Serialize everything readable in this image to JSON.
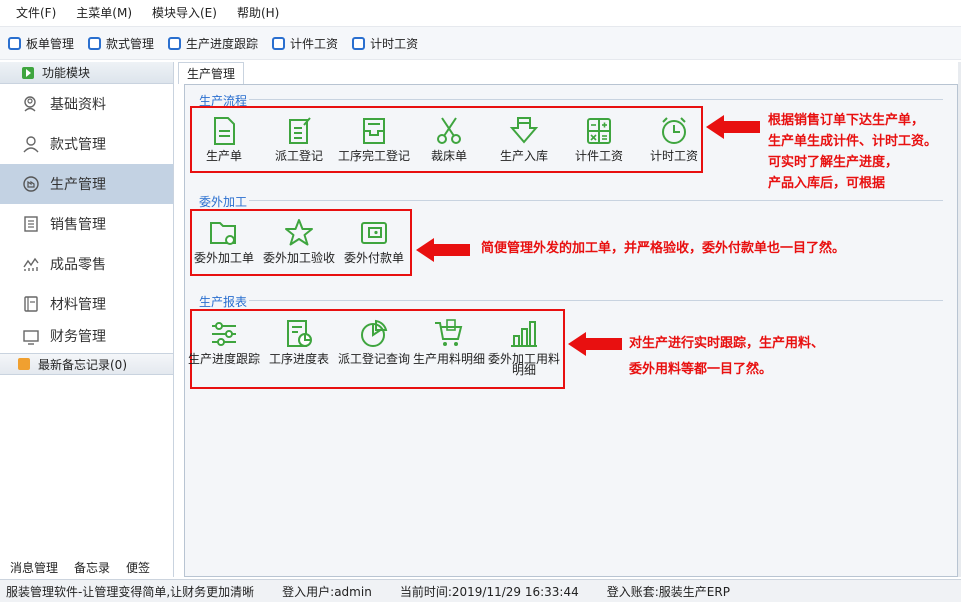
{
  "menu": [
    "文件(F)",
    "主菜单(M)",
    "模块导入(E)",
    "帮助(H)"
  ],
  "toolbar": [
    "板单管理",
    "款式管理",
    "生产进度跟踪",
    "计件工资",
    "计时工资"
  ],
  "sidebar": {
    "header": "功能模块",
    "items": [
      {
        "label": "基础资料",
        "icon": "search-user-icon",
        "active": false
      },
      {
        "label": "款式管理",
        "icon": "user-icon",
        "active": false
      },
      {
        "label": "生产管理",
        "icon": "factory-icon",
        "active": true
      },
      {
        "label": "销售管理",
        "icon": "document-icon",
        "active": false
      },
      {
        "label": "成品零售",
        "icon": "chart-icon",
        "active": false
      },
      {
        "label": "材料管理",
        "icon": "notebook-icon",
        "active": false
      },
      {
        "label": "财务管理",
        "icon": "monitor-icon",
        "active": false
      }
    ],
    "memo": "最新备忘记录(0)",
    "bottom": [
      "消息管理",
      "备忘录",
      "便签"
    ]
  },
  "tab": "生产管理",
  "sections": {
    "process": {
      "title": "生产流程",
      "items": [
        "生产单",
        "派工登记",
        "工序完工登记",
        "裁床单",
        "生产入库",
        "计件工资",
        "计时工资"
      ]
    },
    "outsource": {
      "title": "委外加工",
      "items": [
        "委外加工单",
        "委外加工验收",
        "委外付款单"
      ]
    },
    "report": {
      "title": "生产报表",
      "items": [
        "生产进度跟踪",
        "工序进度表",
        "派工登记查询",
        "生产用料明细",
        "委外加工用料明细"
      ]
    }
  },
  "notes": {
    "process": [
      "根据销售订单下达生产单，",
      "生产单生成计件、计时工资。",
      "可实时了解生产进度，",
      "产品入库后，可根据"
    ],
    "outsource": "简便管理外发的加工单，并严格验收，委外付款单也一目了然。",
    "report": [
      "对生产进行实时跟踪，生产用料、",
      "委外用料等都一目了然。"
    ]
  },
  "status": {
    "app": "服装管理软件-让管理变得简单,让财务更加清晰",
    "user": "登入用户:admin",
    "time": "当前时间:2019/11/29 16:33:44",
    "account": "登入账套:服装生产ERP"
  },
  "colors": {
    "accent": "#2a6fcf",
    "icon_green": "#3fa53f",
    "annotation_red": "#e81010",
    "active_bg": "#c3d2e3"
  }
}
